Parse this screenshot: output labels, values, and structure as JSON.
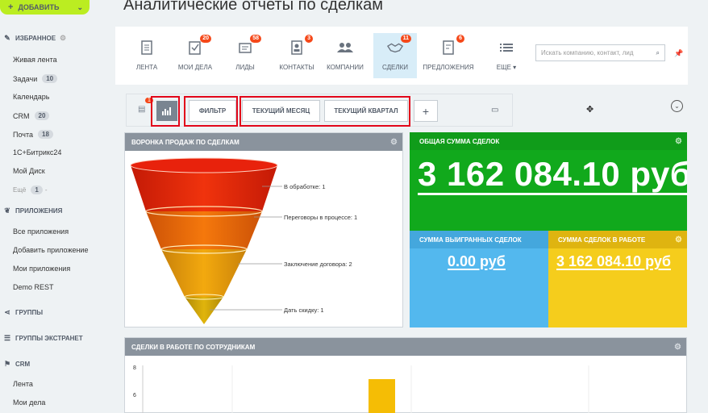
{
  "sidebar": {
    "add_button": "ДОБАВИТЬ",
    "favorites_header": "ИЗБРАННОЕ",
    "favorites": [
      {
        "label": "Живая лента",
        "count": ""
      },
      {
        "label": "Задачи",
        "count": "10"
      },
      {
        "label": "Календарь",
        "count": ""
      },
      {
        "label": "CRM",
        "count": "20"
      },
      {
        "label": "Почта",
        "count": "18"
      },
      {
        "label": "1С+Битрикс24",
        "count": ""
      },
      {
        "label": "Мой Диск",
        "count": ""
      }
    ],
    "more_label": "Ещё",
    "more_count": "1",
    "apps_header": "ПРИЛОЖЕНИЯ",
    "apps": [
      "Все приложения",
      "Добавить приложение",
      "Мои приложения",
      "Demo REST"
    ],
    "groups_header": "ГРУППЫ",
    "extranet_header": "ГРУППЫ ЭКСТРАНЕТ",
    "crm_header": "CRM",
    "crm_items": [
      "Лента",
      "Мои дела"
    ]
  },
  "header": {
    "title": "Аналитические отчеты по сделкам"
  },
  "nav": {
    "items": [
      {
        "label": "ЛЕНТА",
        "badge": ""
      },
      {
        "label": "МОИ ДЕЛА",
        "badge": "20"
      },
      {
        "label": "ЛИДЫ",
        "badge": "58"
      },
      {
        "label": "КОНТАКТЫ",
        "badge": "3"
      },
      {
        "label": "КОМПАНИИ",
        "badge": ""
      },
      {
        "label": "СДЕЛКИ",
        "badge": "11"
      },
      {
        "label": "ПРЕДЛОЖЕНИЯ",
        "badge": "6"
      },
      {
        "label": "ЕЩЕ ▾",
        "badge": ""
      }
    ],
    "search_placeholder": "Искать компанию, контакт, лид"
  },
  "toolbar": {
    "badge": "1",
    "filter": "ФИЛЬТР",
    "current_month": "ТЕКУЩИЙ МЕСЯЦ",
    "current_quarter": "ТЕКУЩИЙ КВАРТАЛ",
    "add": "+"
  },
  "funnel": {
    "title": "ВОРОНКА ПРОДАЖ ПО СДЕЛКАМ",
    "stages": [
      {
        "label": "В обработке: 1",
        "color": "#e8210b"
      },
      {
        "label": "Переговоры в процессе: 1",
        "color": "#f0670a"
      },
      {
        "label": "Заключение договора: 2",
        "color": "#f19a0a"
      },
      {
        "label": "Дать скидку: 1",
        "color": "#d6a40a"
      }
    ]
  },
  "totals": {
    "total_title": "ОБЩАЯ СУММА СДЕЛОК",
    "total_value": "3 162 084.10 руб",
    "won_title": "СУММА ВЫИГРАННЫХ СДЕЛОК",
    "won_value": "0.00 руб",
    "inwork_title": "СУММА СДЕЛОК В РАБОТЕ",
    "inwork_value": "3 162 084.10 руб",
    "colors": {
      "total": "#11a91c",
      "won": "#53b8ee",
      "inwork": "#f5cd1c"
    }
  },
  "employees_chart": {
    "title": "СДЕЛКИ В РАБОТЕ ПО СОТРУДНИКАМ"
  },
  "chart_data": {
    "type": "bar",
    "title": "СДЕЛКИ В РАБОТЕ ПО СОТРУДНИКАМ",
    "y_ticks": [
      "8",
      "6"
    ],
    "series": [
      {
        "values": [
          7
        ]
      }
    ],
    "bar_color": "#f5bd05"
  }
}
